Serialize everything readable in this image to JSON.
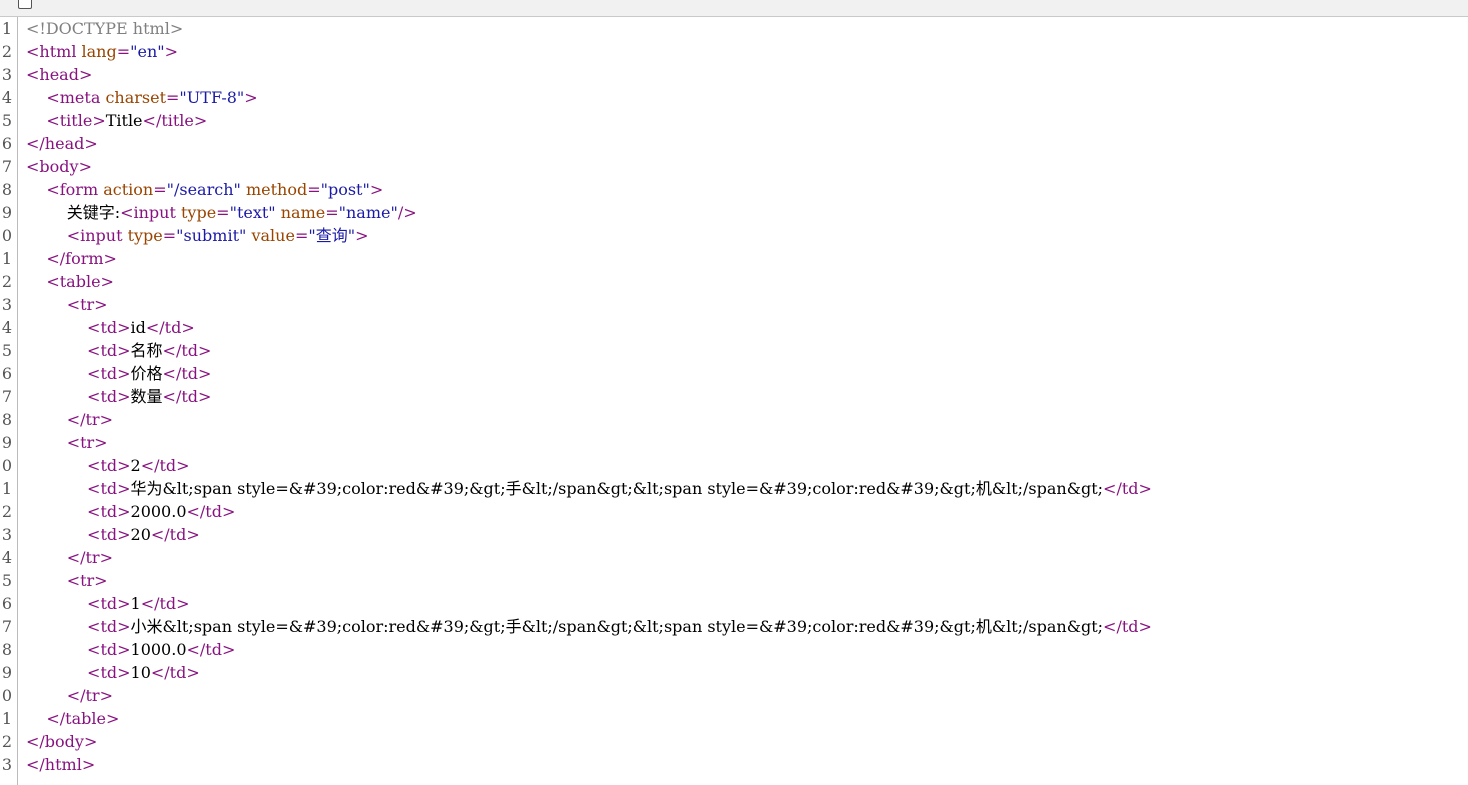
{
  "window": {
    "wrap_checkbox_checked": false
  },
  "source": {
    "lines": [
      {
        "n": "1",
        "t": [
          [
            "cmt",
            "<!DOCTYPE html>"
          ]
        ]
      },
      {
        "n": "2",
        "t": [
          [
            "tag",
            "<html "
          ],
          [
            "attr",
            "lang"
          ],
          [
            "tag",
            "="
          ],
          [
            "val",
            "\"en\""
          ],
          [
            "tag",
            ">"
          ]
        ]
      },
      {
        "n": "3",
        "t": [
          [
            "tag",
            "<head>"
          ]
        ]
      },
      {
        "n": "4",
        "t": [
          [
            "txt",
            "    "
          ],
          [
            "tag",
            "<meta "
          ],
          [
            "attr",
            "charset"
          ],
          [
            "tag",
            "="
          ],
          [
            "val",
            "\"UTF-8\""
          ],
          [
            "tag",
            ">"
          ]
        ]
      },
      {
        "n": "5",
        "t": [
          [
            "txt",
            "    "
          ],
          [
            "tag",
            "<title>"
          ],
          [
            "txt",
            "Title"
          ],
          [
            "tag",
            "</title>"
          ]
        ]
      },
      {
        "n": "6",
        "t": [
          [
            "tag",
            "</head>"
          ]
        ]
      },
      {
        "n": "7",
        "t": [
          [
            "tag",
            "<body>"
          ]
        ]
      },
      {
        "n": "8",
        "t": [
          [
            "txt",
            "    "
          ],
          [
            "tag",
            "<form "
          ],
          [
            "attr",
            "action"
          ],
          [
            "tag",
            "="
          ],
          [
            "val",
            "\"/search\""
          ],
          [
            "tag",
            " "
          ],
          [
            "attr",
            "method"
          ],
          [
            "tag",
            "="
          ],
          [
            "val",
            "\"post\""
          ],
          [
            "tag",
            ">"
          ]
        ]
      },
      {
        "n": "9",
        "t": [
          [
            "txt",
            "        关键字:"
          ],
          [
            "tag",
            "<input "
          ],
          [
            "attr",
            "type"
          ],
          [
            "tag",
            "="
          ],
          [
            "val",
            "\"text\""
          ],
          [
            "tag",
            " "
          ],
          [
            "attr",
            "name"
          ],
          [
            "tag",
            "="
          ],
          [
            "val",
            "\"name\""
          ],
          [
            "tag",
            "/>"
          ]
        ]
      },
      {
        "n": "0",
        "t": [
          [
            "txt",
            "        "
          ],
          [
            "tag",
            "<input "
          ],
          [
            "attr",
            "type"
          ],
          [
            "tag",
            "="
          ],
          [
            "val",
            "\"submit\""
          ],
          [
            "tag",
            " "
          ],
          [
            "attr",
            "value"
          ],
          [
            "tag",
            "="
          ],
          [
            "val",
            "\"查询\""
          ],
          [
            "tag",
            ">"
          ]
        ]
      },
      {
        "n": "1",
        "t": [
          [
            "txt",
            "    "
          ],
          [
            "tag",
            "</form>"
          ]
        ]
      },
      {
        "n": "2",
        "t": [
          [
            "txt",
            "    "
          ],
          [
            "tag",
            "<table>"
          ]
        ]
      },
      {
        "n": "3",
        "t": [
          [
            "txt",
            "        "
          ],
          [
            "tag",
            "<tr>"
          ]
        ]
      },
      {
        "n": "4",
        "t": [
          [
            "txt",
            "            "
          ],
          [
            "tag",
            "<td>"
          ],
          [
            "txt",
            "id"
          ],
          [
            "tag",
            "</td>"
          ]
        ]
      },
      {
        "n": "5",
        "t": [
          [
            "txt",
            "            "
          ],
          [
            "tag",
            "<td>"
          ],
          [
            "txt",
            "名称"
          ],
          [
            "tag",
            "</td>"
          ]
        ]
      },
      {
        "n": "6",
        "t": [
          [
            "txt",
            "            "
          ],
          [
            "tag",
            "<td>"
          ],
          [
            "txt",
            "价格"
          ],
          [
            "tag",
            "</td>"
          ]
        ]
      },
      {
        "n": "7",
        "t": [
          [
            "txt",
            "            "
          ],
          [
            "tag",
            "<td>"
          ],
          [
            "txt",
            "数量"
          ],
          [
            "tag",
            "</td>"
          ]
        ]
      },
      {
        "n": "8",
        "t": [
          [
            "txt",
            "        "
          ],
          [
            "tag",
            "</tr>"
          ]
        ]
      },
      {
        "n": "9",
        "t": [
          [
            "txt",
            "        "
          ],
          [
            "tag",
            "<tr>"
          ]
        ]
      },
      {
        "n": "0",
        "t": [
          [
            "txt",
            "            "
          ],
          [
            "tag",
            "<td>"
          ],
          [
            "txt",
            "2"
          ],
          [
            "tag",
            "</td>"
          ]
        ]
      },
      {
        "n": "1",
        "t": [
          [
            "txt",
            "            "
          ],
          [
            "tag",
            "<td>"
          ],
          [
            "txt",
            "华为&lt;span style=&#39;color:red&#39;&gt;手&lt;/span&gt;&lt;span style=&#39;color:red&#39;&gt;机&lt;/span&gt;"
          ],
          [
            "tag",
            "</td>"
          ]
        ]
      },
      {
        "n": "2",
        "t": [
          [
            "txt",
            "            "
          ],
          [
            "tag",
            "<td>"
          ],
          [
            "txt",
            "2000.0"
          ],
          [
            "tag",
            "</td>"
          ]
        ]
      },
      {
        "n": "3",
        "t": [
          [
            "txt",
            "            "
          ],
          [
            "tag",
            "<td>"
          ],
          [
            "txt",
            "20"
          ],
          [
            "tag",
            "</td>"
          ]
        ]
      },
      {
        "n": "4",
        "t": [
          [
            "txt",
            "        "
          ],
          [
            "tag",
            "</tr>"
          ]
        ]
      },
      {
        "n": "5",
        "t": [
          [
            "txt",
            "        "
          ],
          [
            "tag",
            "<tr>"
          ]
        ]
      },
      {
        "n": "6",
        "t": [
          [
            "txt",
            "            "
          ],
          [
            "tag",
            "<td>"
          ],
          [
            "txt",
            "1"
          ],
          [
            "tag",
            "</td>"
          ]
        ]
      },
      {
        "n": "7",
        "t": [
          [
            "txt",
            "            "
          ],
          [
            "tag",
            "<td>"
          ],
          [
            "txt",
            "小米&lt;span style=&#39;color:red&#39;&gt;手&lt;/span&gt;&lt;span style=&#39;color:red&#39;&gt;机&lt;/span&gt;"
          ],
          [
            "tag",
            "</td>"
          ]
        ]
      },
      {
        "n": "8",
        "t": [
          [
            "txt",
            "            "
          ],
          [
            "tag",
            "<td>"
          ],
          [
            "txt",
            "1000.0"
          ],
          [
            "tag",
            "</td>"
          ]
        ]
      },
      {
        "n": "9",
        "t": [
          [
            "txt",
            "            "
          ],
          [
            "tag",
            "<td>"
          ],
          [
            "txt",
            "10"
          ],
          [
            "tag",
            "</td>"
          ]
        ]
      },
      {
        "n": "0",
        "t": [
          [
            "txt",
            "        "
          ],
          [
            "tag",
            "</tr>"
          ]
        ]
      },
      {
        "n": "1",
        "t": [
          [
            "txt",
            "    "
          ],
          [
            "tag",
            "</table>"
          ]
        ]
      },
      {
        "n": "2",
        "t": [
          [
            "tag",
            "</body>"
          ]
        ]
      },
      {
        "n": "3",
        "t": [
          [
            "tag",
            "</html>"
          ]
        ]
      }
    ]
  }
}
